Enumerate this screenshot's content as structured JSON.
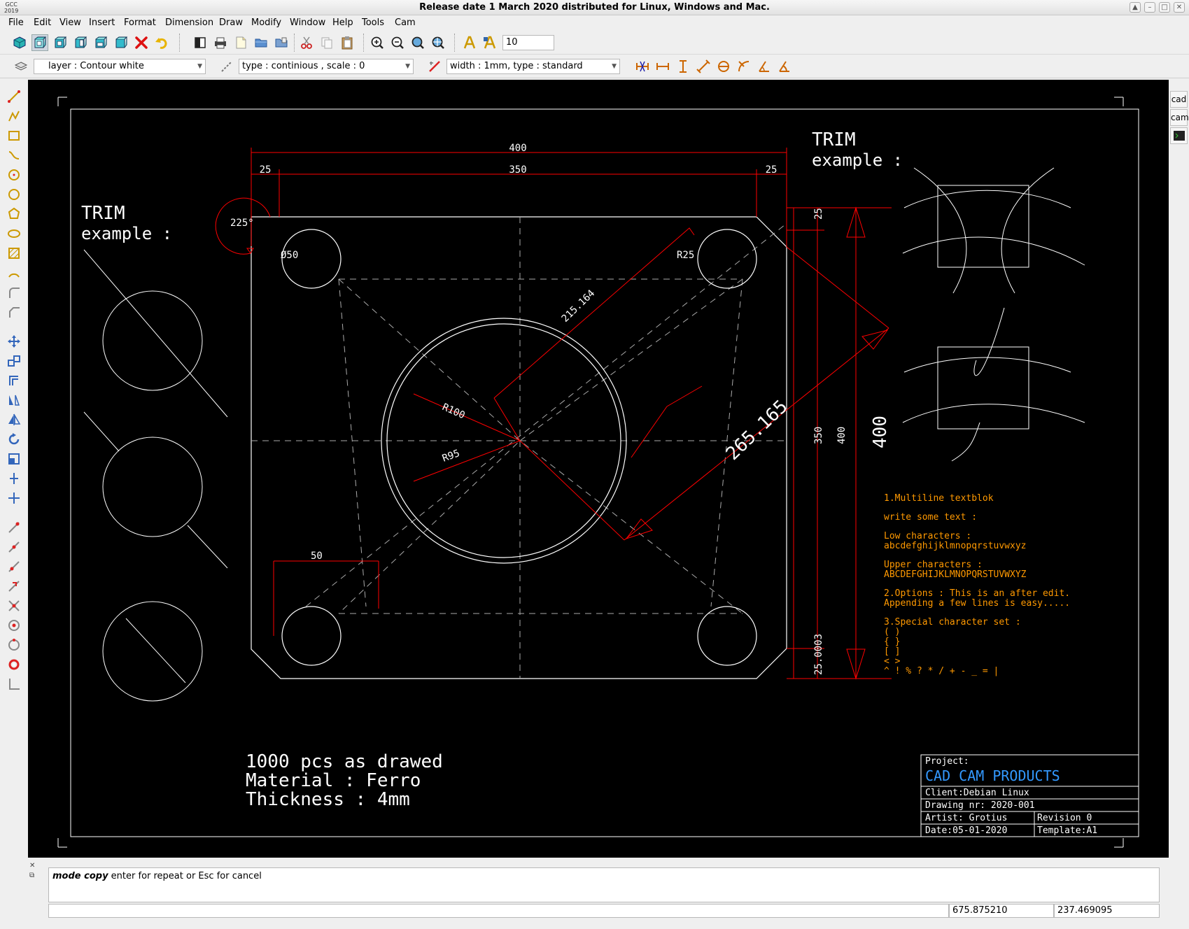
{
  "window": {
    "title": "Release date 1 March 2020 distributed for Linux, Windows and Mac.",
    "logo_line1": "GCC",
    "logo_line2": "2019"
  },
  "menu": [
    "File",
    "Edit",
    "View",
    "Insert",
    "Format",
    "Dimension",
    "Draw",
    "Modify",
    "Window",
    "Help",
    "Tools",
    "Cam"
  ],
  "toolbar": {
    "zoom_value": "10",
    "layer_combo": "layer : Contour white",
    "linetype_combo": "type : continious , scale : 0",
    "width_combo": "width : 1mm, type : standard"
  },
  "right_tabs": [
    "cad",
    "cam"
  ],
  "drawing": {
    "dims": {
      "d400_top": "400",
      "d350_top": "350",
      "d25_left": "25",
      "d25_right": "25",
      "angle": "225°",
      "dia50": "Ø50",
      "r25": "R25",
      "aligned_215": "215.164",
      "r100": "R100",
      "r95": "R95",
      "aligned_265": "265.165",
      "d50": "50",
      "d25_vert": "25",
      "d350_vert": "350",
      "d400_vert": "400",
      "d400_big": "400",
      "d25b_vert": "25.0003"
    },
    "trim_left": [
      "TRIM",
      "example :"
    ],
    "trim_right": [
      "TRIM",
      "example :"
    ],
    "notes": [
      "1000 pcs as drawed",
      "Material : Ferro",
      "Thickness : 4mm"
    ],
    "textblock": [
      "1.Multiline textblok",
      "write some text :",
      "Low characters :",
      "abcdefghijklmnopqrstuvwxyz",
      "Upper characters :",
      "ABCDEFGHIJKLMNOPQRSTUVWXYZ",
      "2.Options : This is an after edit.",
      "Appending a few lines is easy.....",
      "3.Special character set :",
      "( )",
      "{ }",
      "[ ]",
      "< >",
      "^ ! % ? * / + - _ = |"
    ],
    "titleblock": {
      "project_label": "Project:",
      "company": "CAD CAM PRODUCTS",
      "client": "Client:Debian Linux",
      "drawing_nr": "Drawing nr: 2020-001",
      "artist": "Artist: Grotius",
      "revision": "Revision    0",
      "date": "Date:05-01-2020",
      "template": "Template:A1"
    },
    "colors": {
      "background": "#000000",
      "white": "#ffffff",
      "dim": "#ff0000",
      "text_orange": "#ff9900",
      "company_blue": "#3399ff"
    }
  },
  "command": {
    "mode": "mode copy",
    "message": " enter for repeat or Esc for cancel",
    "coord_x": "675.875210",
    "coord_y": "237.469095"
  }
}
